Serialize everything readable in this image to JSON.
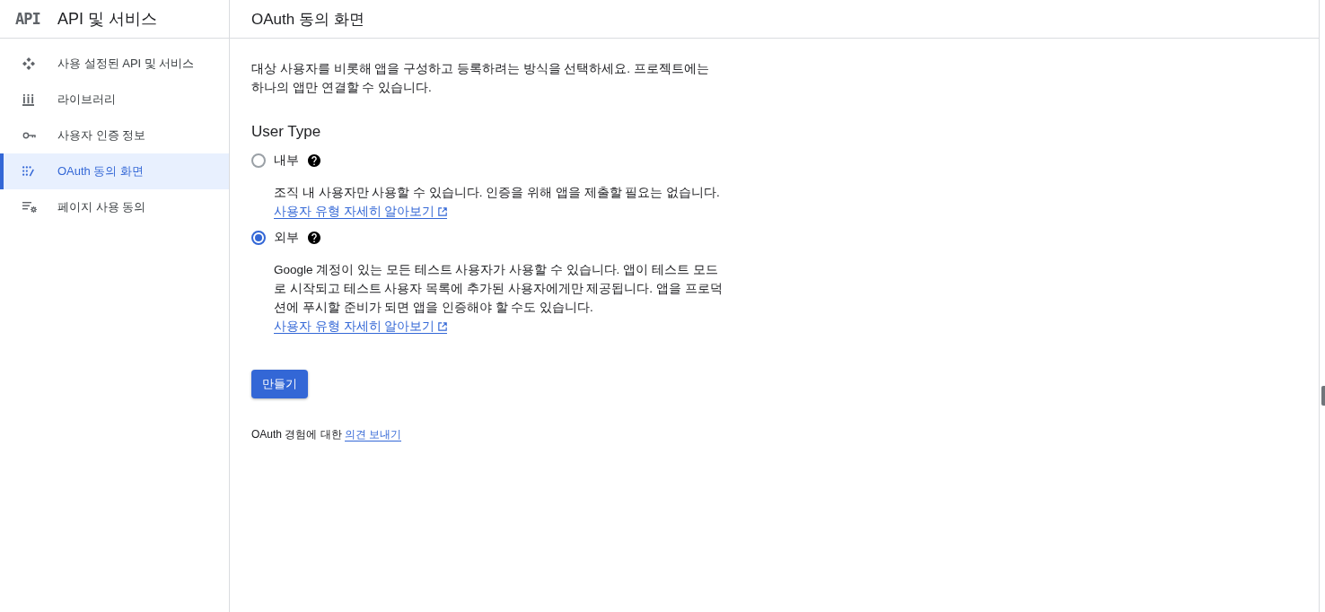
{
  "sidebar": {
    "logo": "API",
    "title": "API 및 서비스",
    "items": [
      {
        "label": "사용 설정된 API 및 서비스",
        "selected": false
      },
      {
        "label": "라이브러리",
        "selected": false
      },
      {
        "label": "사용자 인증 정보",
        "selected": false
      },
      {
        "label": "OAuth 동의 화면",
        "selected": true
      },
      {
        "label": "페이지 사용 동의",
        "selected": false
      }
    ]
  },
  "page": {
    "title": "OAuth 동의 화면",
    "intro": "대상 사용자를 비롯해 앱을 구성하고 등록하려는 방식을 선택하세요. 프로젝트에는 하나의 앱만 연결할 수 있습니다.",
    "section_title": "User Type",
    "options": [
      {
        "label": "내부",
        "selected": false,
        "description": "조직 내 사용자만 사용할 수 있습니다. 인증을 위해 앱을 제출할 필요는 없습니다.",
        "link": "사용자 유형 자세히 알아보기"
      },
      {
        "label": "외부",
        "selected": true,
        "description": "Google 계정이 있는 모든 테스트 사용자가 사용할 수 있습니다. 앱이 테스트 모드로 시작되고 테스트 사용자 목록에 추가된 사용자에게만 제공됩니다. 앱을 프로덕션에 푸시할 준비가 되면 앱을 인증해야 할 수도 있습니다.",
        "link": "사용자 유형 자세히 알아보기"
      }
    ],
    "create_button": "만들기",
    "feedback": {
      "text": "OAuth 경험에 대한",
      "link": "의견 보내기"
    }
  }
}
